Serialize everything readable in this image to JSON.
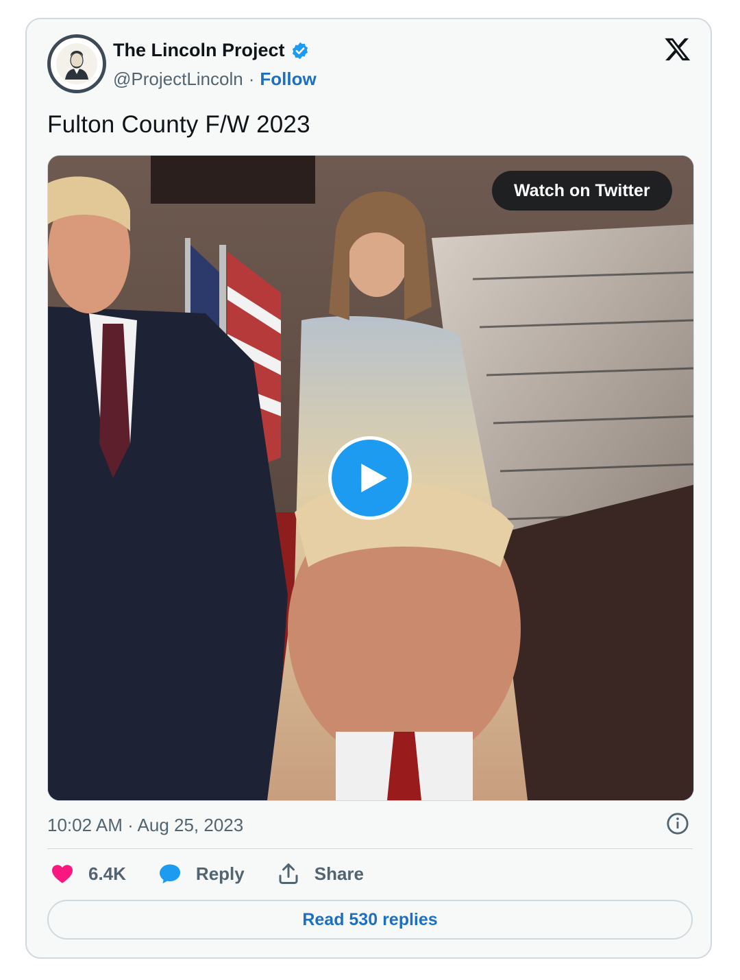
{
  "author": {
    "display_name": "The Lincoln Project",
    "handle": "@ProjectLincoln",
    "separator": "·",
    "follow_label": "Follow"
  },
  "tweet": {
    "text": "Fulton County F/W 2023",
    "timestamp": "10:02 AM · Aug 25, 2023"
  },
  "media": {
    "watch_label": "Watch on Twitter"
  },
  "actions": {
    "likes": "6.4K",
    "reply_label": "Reply",
    "share_label": "Share"
  },
  "read_replies_label": "Read 530 replies",
  "colors": {
    "accent": "#1d9bf0",
    "link": "#1d6fc2",
    "like": "#f91880",
    "muted": "#536471",
    "card_bg": "#f7f9f9",
    "border": "#cfd9de"
  },
  "icons": {
    "verified": "verified-badge-icon",
    "platform": "x-logo-icon",
    "play": "play-icon",
    "info": "info-icon",
    "like": "heart-icon",
    "reply": "speech-bubble-icon",
    "share": "share-upload-icon"
  }
}
